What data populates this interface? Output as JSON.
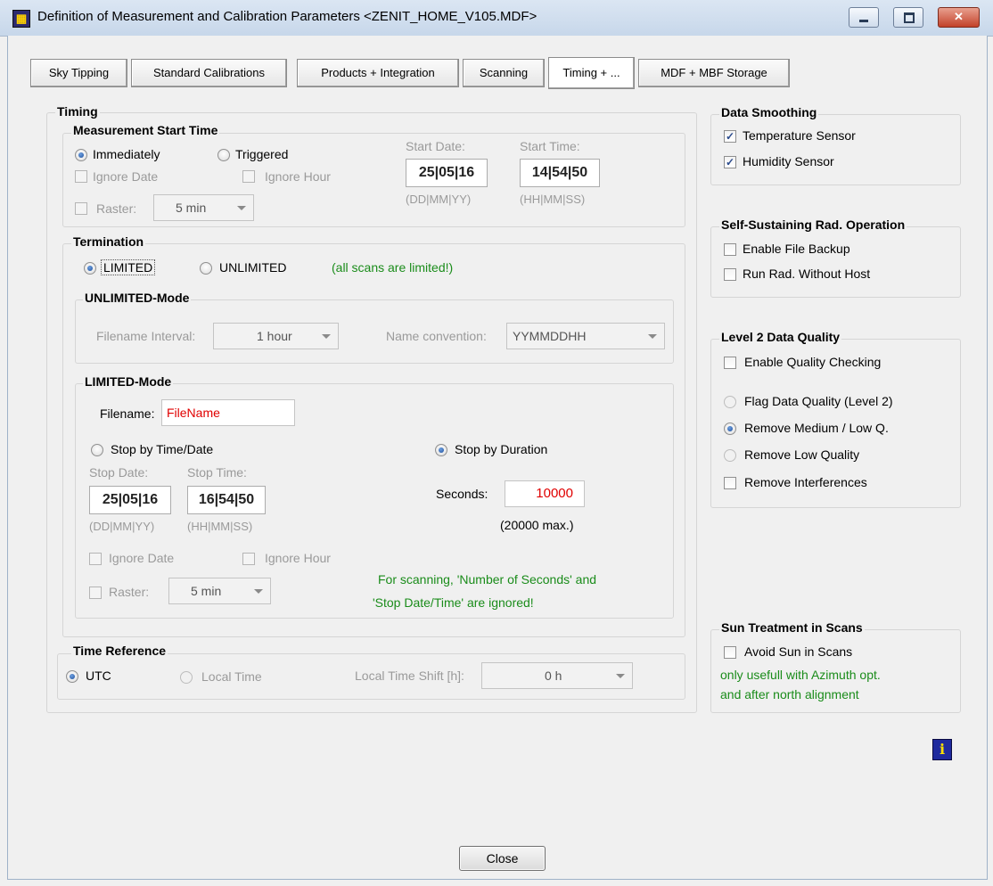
{
  "window": {
    "title": "Definition of Measurement and Calibration Parameters  <ZENIT_HOME_V105.MDF>",
    "icon": "app-icon",
    "minimize_icon": "minimize-icon",
    "maximize_icon": "maximize-icon",
    "close_icon": "close-icon",
    "close_glyph": "✕"
  },
  "tabs": [
    {
      "label": "Sky Tipping"
    },
    {
      "label": "Standard Calibrations"
    },
    {
      "label": "Products + Integration"
    },
    {
      "label": "Scanning"
    },
    {
      "label": "Timing + ..."
    },
    {
      "label": "MDF + MBF Storage"
    }
  ],
  "timing": {
    "title": "Timing",
    "start": {
      "title": "Measurement Start Time",
      "immediately": "Immediately",
      "triggered": "Triggered",
      "ignore_date": "Ignore Date",
      "ignore_hour": "Ignore Hour",
      "raster": "Raster:",
      "raster_value": "5 min",
      "start_date_label": "Start Date:",
      "start_date": "25|05|16",
      "start_date_fmt": "(DD|MM|YY)",
      "start_time_label": "Start Time:",
      "start_time": "14|54|50",
      "start_time_fmt": "(HH|MM|SS)"
    },
    "termination": {
      "title": "Termination",
      "limited": "LIMITED",
      "unlimited": "UNLIMITED",
      "note": "(all scans are limited!)",
      "unlimited_mode": {
        "title": "UNLIMITED-Mode",
        "filename_interval_label": "Filename Interval:",
        "filename_interval": "1 hour",
        "name_convention_label": "Name convention:",
        "name_convention": "YYMMDDHH"
      },
      "limited_mode": {
        "title": "LIMITED-Mode",
        "filename_label": "Filename:",
        "filename": "FileName",
        "stop_by_time": "Stop by Time/Date",
        "stop_by_duration": "Stop by Duration",
        "stop_date_label": "Stop Date:",
        "stop_date": "25|05|16",
        "stop_date_fmt": "(DD|MM|YY)",
        "stop_time_label": "Stop Time:",
        "stop_time": "16|54|50",
        "stop_time_fmt": "(HH|MM|SS)",
        "seconds_label": "Seconds:",
        "seconds": "10000",
        "seconds_max": "(20000 max.)",
        "ignore_date": "Ignore Date",
        "ignore_hour": "Ignore Hour",
        "raster": "Raster:",
        "raster_value": "5 min",
        "scan_note_1": "For scanning, 'Number of Seconds' and",
        "scan_note_2": "'Stop Date/Time' are ignored!"
      }
    },
    "time_reference": {
      "title": "Time Reference",
      "utc": "UTC",
      "local": "Local Time",
      "shift_label": "Local Time Shift [h]:",
      "shift_value": "0 h"
    }
  },
  "data_smoothing": {
    "title": "Data Smoothing",
    "temperature": "Temperature Sensor",
    "humidity": "Humidity Sensor"
  },
  "self_sustaining": {
    "title": "Self-Sustaining Rad. Operation",
    "file_backup": "Enable File Backup",
    "run_without_host": "Run Rad. Without Host"
  },
  "level2": {
    "title": "Level 2 Data Quality",
    "enable": "Enable Quality Checking",
    "flag": "Flag Data Quality (Level 2)",
    "remove_medium_low": "Remove Medium / Low Q.",
    "remove_low": "Remove Low Quality",
    "remove_interferences": "Remove Interferences"
  },
  "sun": {
    "title": "Sun Treatment in Scans",
    "avoid": "Avoid Sun in Scans",
    "note_1": "only usefull with Azimuth opt.",
    "note_2": "and after north alignment"
  },
  "info_glyph": "i",
  "close_button": "Close",
  "check_mark": "✓",
  "colors": {
    "green_note": "#1a8c1a",
    "red_value": "#e00000",
    "title_gradient_top": "#dbe6f3",
    "close_button_red": "#c2422a"
  }
}
